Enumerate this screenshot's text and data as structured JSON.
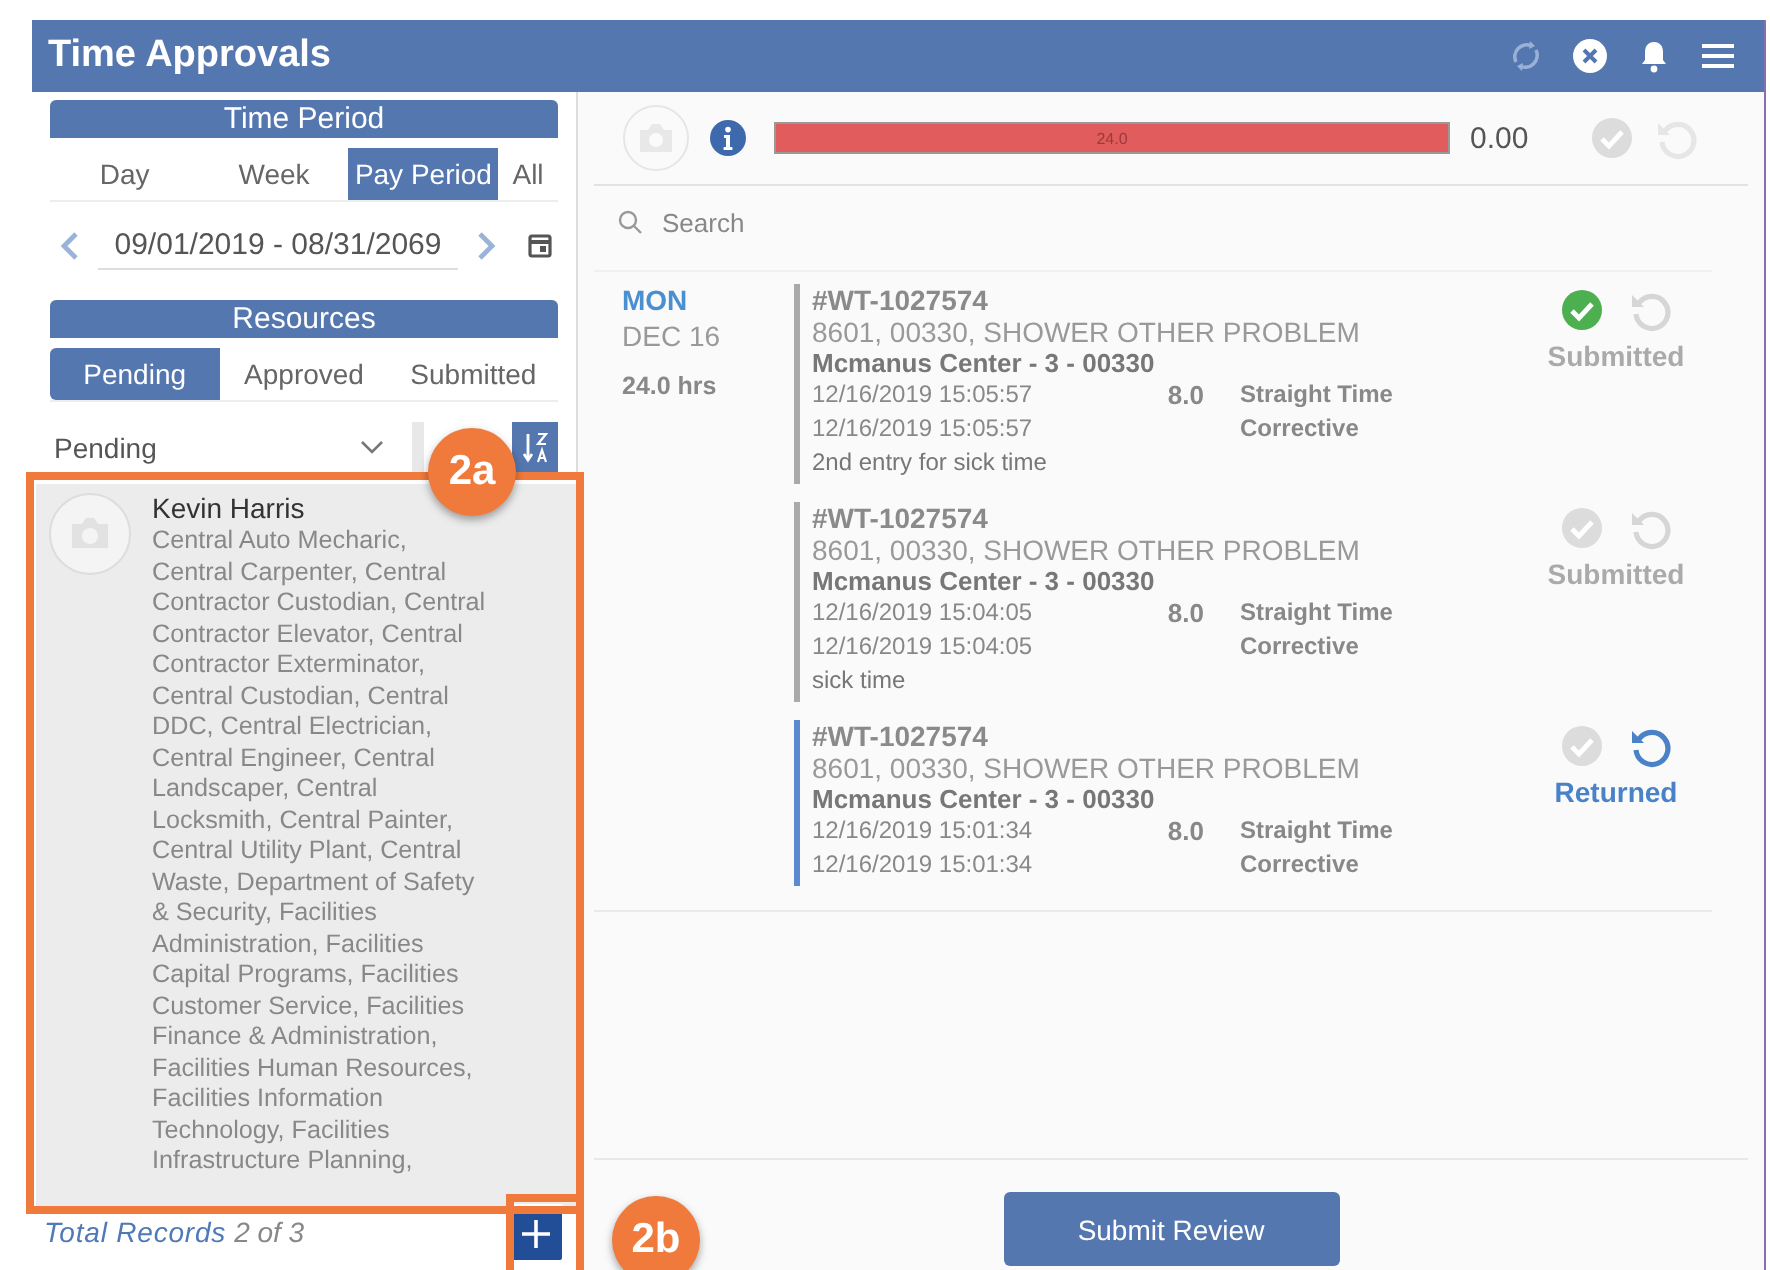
{
  "header": {
    "title": "Time Approvals"
  },
  "time_period": {
    "title": "Time Period",
    "tabs": [
      {
        "label": "Day",
        "selected": false
      },
      {
        "label": "Week",
        "selected": false
      },
      {
        "label": "Pay Period",
        "selected": true
      },
      {
        "label": "All",
        "selected": false
      }
    ],
    "date_range": "09/01/2019 - 08/31/2069"
  },
  "resources": {
    "title": "Resources",
    "tabs": [
      {
        "label": "Pending",
        "selected": true
      },
      {
        "label": "Approved",
        "selected": false
      },
      {
        "label": "Submitted",
        "selected": false
      }
    ],
    "filter": {
      "value": "Pending"
    },
    "cards": [
      {
        "name": "Kevin Harris",
        "roles": "Central Auto Mecharic, Central Carpenter, Central Contractor Custodian, Central Contractor Elevator, Central Contractor Exterminator, Central Custodian, Central DDC, Central Electrician, Central Engineer, Central Landscaper, Central Locksmith, Central Painter, Central Utility Plant, Central Waste, Department of Safety & Security, Facilities Administration, Facilities Capital Programs, Facilities Customer Service, Facilities Finance & Administration, Facilities Human Resources, Facilities Information Technology, Facilities Infrastructure Planning,"
      }
    ],
    "total_label": "Total Records",
    "total_count": "2 of 3"
  },
  "summary": {
    "bar_label": "24.0",
    "level": 1,
    "total": "0.00"
  },
  "search": {
    "placeholder": "Search"
  },
  "days": [
    {
      "weekday": "MON",
      "date": "DEC 16",
      "hours": "24.0 hrs",
      "entries": [
        {
          "number": "#WT-1027574",
          "title": "8601, 00330, SHOWER OTHER PROBLEM",
          "location": "Mcmanus Center - 3 - 00330",
          "start": "12/16/2019 15:05:57",
          "hours": "8.0",
          "pay_type": "Straight Time",
          "end": "12/16/2019 15:05:57",
          "work_type": "Corrective",
          "note": "2nd entry for sick time",
          "approved": true,
          "status": {
            "label": "Submitted",
            "kind": "submitted"
          }
        },
        {
          "number": "#WT-1027574",
          "title": "8601, 00330, SHOWER OTHER PROBLEM",
          "location": "Mcmanus Center - 3 - 00330",
          "start": "12/16/2019 15:04:05",
          "hours": "8.0",
          "pay_type": "Straight Time",
          "end": "12/16/2019 15:04:05",
          "work_type": "Corrective",
          "note": "sick time",
          "approved": false,
          "status": {
            "label": "Submitted",
            "kind": "submitted"
          }
        },
        {
          "number": "#WT-1027574",
          "title": "8601, 00330, SHOWER OTHER PROBLEM",
          "location": "Mcmanus Center - 3 - 00330",
          "start": "12/16/2019 15:01:34",
          "hours": "8.0",
          "pay_type": "Straight Time",
          "end": "12/16/2019 15:01:34",
          "work_type": "Corrective",
          "approved": false,
          "status": {
            "label": "Returned",
            "kind": "returned"
          }
        }
      ]
    }
  ],
  "submit_button": "Submit Review",
  "annotations": [
    {
      "label": "2a"
    },
    {
      "label": "2b"
    }
  ]
}
